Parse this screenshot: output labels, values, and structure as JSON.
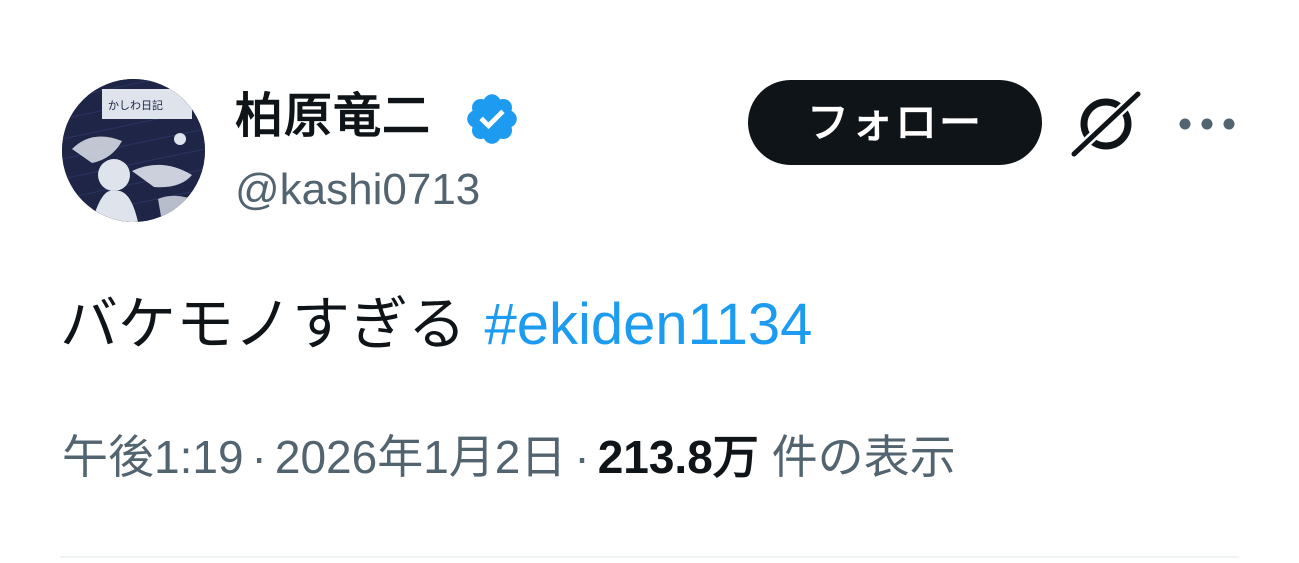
{
  "author": {
    "display_name": "柏原竜二",
    "handle": "@kashi0713",
    "verified": true,
    "avatar": "avatar-illustration"
  },
  "actions": {
    "follow_label": "フォロー",
    "grok_icon": "grok-icon",
    "more_icon": "more-dots-icon"
  },
  "tweet": {
    "text": "バケモノすぎる",
    "hashtag": "#ekiden1134"
  },
  "meta": {
    "time": "午後1:19",
    "separator": "·",
    "date": "2026年1月2日",
    "views_count": "213.8万",
    "views_label": "件の表示"
  },
  "colors": {
    "accent": "#1d9bf0",
    "text_primary": "#0f1419",
    "text_secondary": "#536471",
    "button_bg": "#0f1419",
    "divider": "#eff3f4"
  }
}
